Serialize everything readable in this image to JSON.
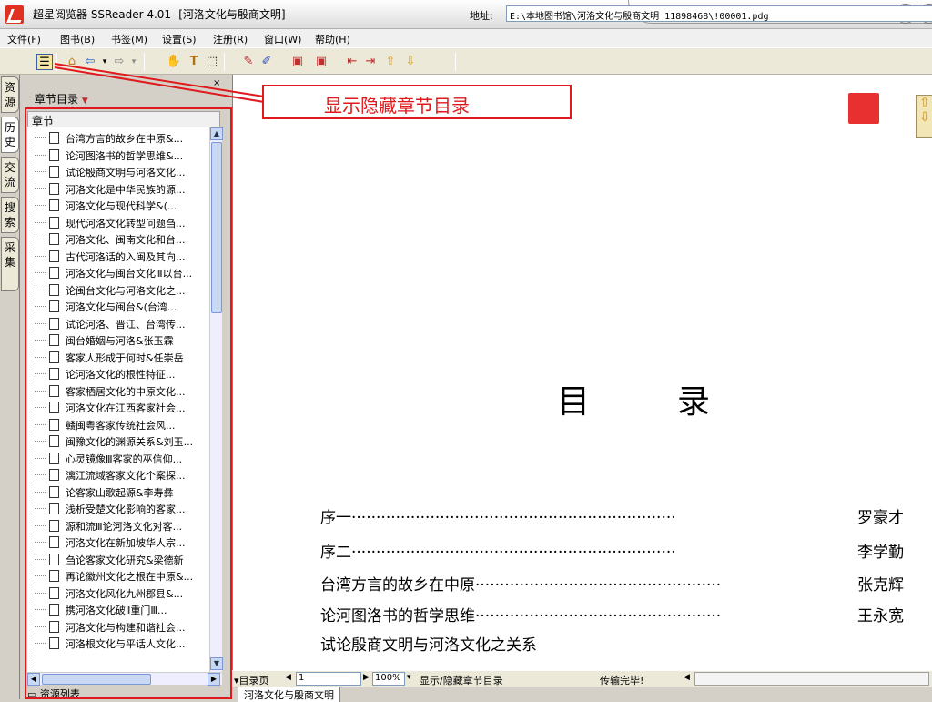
{
  "window": {
    "title": "超星阅览器 SSReader 4.01 -[河洛文化与殷商文明]"
  },
  "menubar": {
    "items": [
      "文件(F)",
      "图书(B)",
      "书签(M)",
      "设置(S)",
      "注册(R)",
      "窗口(W)",
      "帮助(H)"
    ]
  },
  "toolbar": {
    "address_label": "地址:",
    "address_value": "E:\\本地图书馆\\河洛文化与殷商文明_11898468\\!00001.pdg"
  },
  "vertical_tabs": [
    "资源",
    "历史",
    "交流",
    "搜索",
    "采集"
  ],
  "left_panel": {
    "close_label": "×",
    "title": "章节目录",
    "tree_header": "章节",
    "items": [
      "台湾方言的故乡在中原&...",
      "论河图洛书的哲学思维&...",
      "试论殷商文明与河洛文化...",
      "河洛文化是中华民族的源...",
      "河洛文化与现代科学&(...",
      "现代河洛文化转型问题刍...",
      "河洛文化、闽南文化和台...",
      "古代河洛话的入闽及其向...",
      "河洛文化与闽台文化Ⅲ以台...",
      "论闽台文化与河洛文化之...",
      "河洛文化与闽台&(台湾...",
      "试论河洛、晋江、台湾传...",
      "闽台婚姻与河洛&张玉霖",
      "客家人形成于何时&任崇岳",
      "论河洛文化的根性特征...",
      "客家栖居文化的中原文化...",
      "河洛文化在江西客家社会...",
      "赣闽粤客家传统社会风...",
      "闽豫文化的渊源关系&刘玉...",
      "心灵镜像Ⅲ客家的巫信仰...",
      "漓江流域客家文化个案探...",
      "论客家山歌起源&李寿彝",
      "浅析受楚文化影响的客家...",
      "源和流Ⅲ论河洛文化对客...",
      "河洛文化在新加坡华人宗...",
      "刍论客家文化研究&梁德新",
      "再论徽州文化之根在中原&...",
      "河洛文化风化九州郡县&...",
      "携河洛文化破Ⅱ重门Ⅲ...",
      "河洛文化与构建和谐社会...",
      "河洛根文化与平话人文化..."
    ],
    "bottom_label": "资源列表"
  },
  "callout": {
    "text": "显示隐藏章节目录"
  },
  "page": {
    "toc_title": "目录",
    "entries": [
      {
        "title": "序一",
        "dots": "··································································",
        "author": "罗豪才"
      },
      {
        "title": "序二",
        "dots": "··································································",
        "author": "李学勤"
      },
      {
        "title": "台湾方言的故乡在中原",
        "dots": "··················································",
        "author": "张克辉"
      },
      {
        "title": "论河图洛书的哲学思维",
        "dots": "··················································",
        "author": "王永宽"
      },
      {
        "title": "试论殷商文明与河洛文化之关系",
        "dots": "",
        "author": ""
      }
    ]
  },
  "statusbar": {
    "toc_toggle": "▾目录页",
    "page_value": "1",
    "zoom_value": "100%",
    "toggle_label": "显示/隐藏章节目录",
    "status_text": "传输完毕!",
    "book_tab": "河洛文化与殷商文明"
  }
}
